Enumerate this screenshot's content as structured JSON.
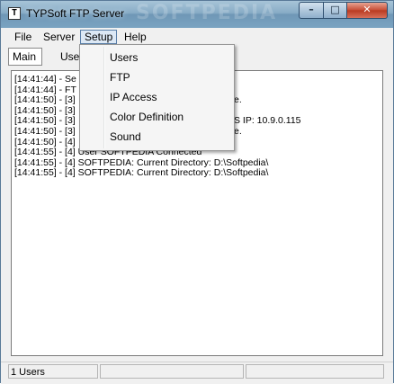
{
  "window": {
    "title": "TYPSoft FTP Server",
    "icon": "ftp-server-icon",
    "icon_glyph": "T",
    "watermark": "SOFTPEDIA"
  },
  "controls": {
    "minimize": "–",
    "maximize": "□",
    "close": "✕"
  },
  "menu": {
    "items": [
      "File",
      "Server",
      "Setup",
      "Help"
    ],
    "active": "Setup"
  },
  "tabs": [
    "Main",
    "Use"
  ],
  "setup_menu": {
    "items": [
      "Users",
      "FTP",
      "IP Access",
      "Color Definition",
      "Sound"
    ]
  },
  "log": {
    "lines": [
      "[14:41:44] - Se",
      "[14:41:44] - FT",
      "[14:41:50] - [3]",
      "[14:41:50] - [3]",
      "[14:41:50] - [3]",
      "[14:41:50] - [3]",
      "[14:41:50] - [4]",
      "[14:41:55] - [4] User SOFTPEDIA Connected",
      "[14:41:55] - [4] SOFTPEDIA: Current Directory: D:\\Softpedia\\",
      "[14:41:55] - [4] SOFTPEDIA: Current Directory: D:\\Softpedia\\"
    ],
    "fragments": {
      "line3": "e.",
      "line5": "S IP: 10.9.0.115",
      "line6": "e."
    }
  },
  "status": {
    "users": "1 Users",
    "pane2": "",
    "pane3": ""
  }
}
